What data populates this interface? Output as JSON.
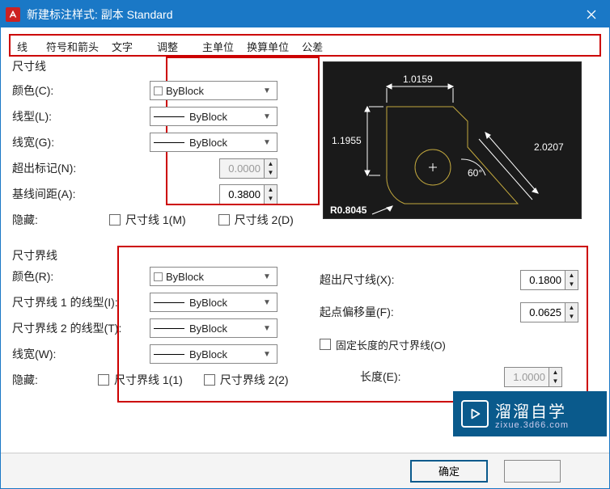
{
  "title": "新建标注样式: 副本 Standard",
  "tabs": [
    "线",
    "符号和箭头",
    "文字",
    "调整",
    "主单位",
    "换算单位",
    "公差"
  ],
  "dimlines": {
    "title": "尺寸线",
    "color_label": "颜色(C):",
    "color_value": "ByBlock",
    "linetype_label": "线型(L):",
    "linetype_value": "ByBlock",
    "lineweight_label": "线宽(G):",
    "lineweight_value": "ByBlock",
    "extend_label": "超出标记(N):",
    "extend_value": "0.0000",
    "baseline_label": "基线间距(A):",
    "baseline_value": "0.3800",
    "hide_label": "隐藏:",
    "chk1": "尺寸线 1(M)",
    "chk2": "尺寸线 2(D)"
  },
  "extlines": {
    "title": "尺寸界线",
    "color_label": "颜色(R):",
    "color_value": "ByBlock",
    "lt1_label": "尺寸界线 1 的线型(I):",
    "lt1_value": "ByBlock",
    "lt2_label": "尺寸界线 2 的线型(T):",
    "lt2_value": "ByBlock",
    "lw_label": "线宽(W):",
    "lw_value": "ByBlock",
    "hide_label": "隐藏:",
    "chk1": "尺寸界线 1(1)",
    "chk2": "尺寸界线 2(2)"
  },
  "right": {
    "beyond_label": "超出尺寸线(X):",
    "beyond_value": "0.1800",
    "offset_label": "起点偏移量(F):",
    "offset_value": "0.0625",
    "fixed_label": "固定长度的尺寸界线(O)",
    "length_label": "长度(E):",
    "length_value": "1.0000"
  },
  "preview": {
    "d1": "1.0159",
    "d2": "1.1955",
    "d3": "2.0207",
    "d4": "60°",
    "d5": "R0.8045"
  },
  "watermark": {
    "brand": "溜溜自学",
    "sub": "zixue.3d66.com"
  },
  "buttons": {
    "ok": "确定"
  }
}
